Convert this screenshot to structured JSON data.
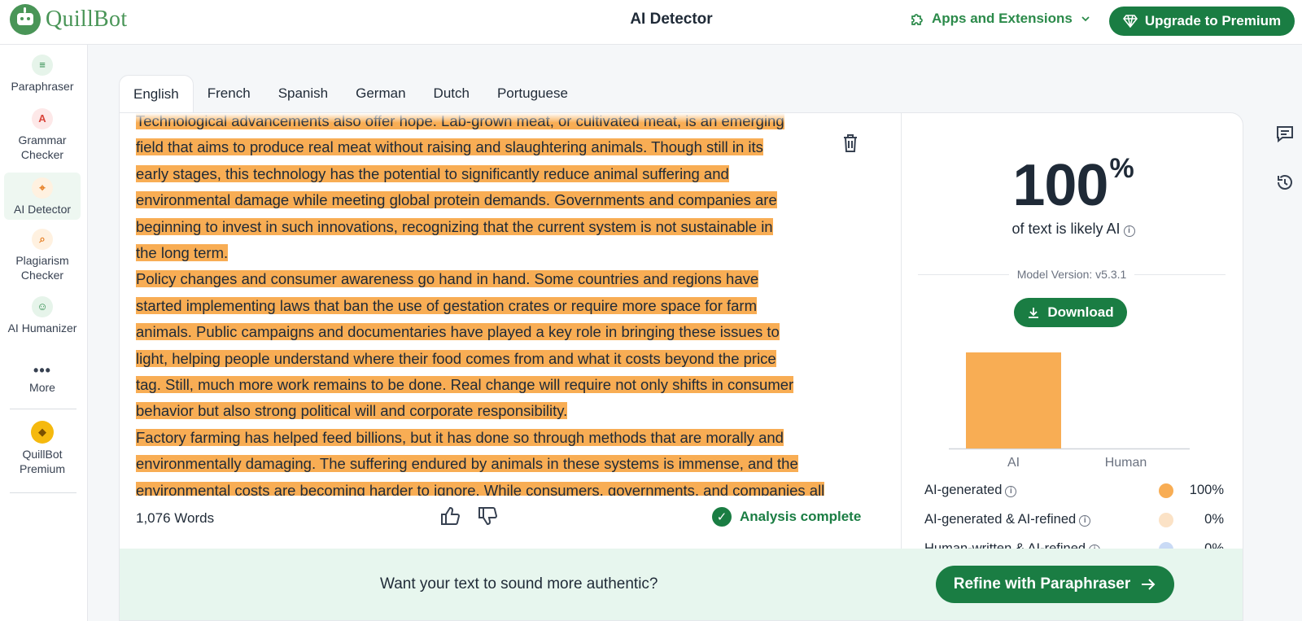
{
  "header": {
    "brand": "QuillBot",
    "title": "AI Detector",
    "apps_label": "Apps and Extensions",
    "upgrade_label": "Upgrade to Premium"
  },
  "sidebar": {
    "items": [
      {
        "label": "Paraphraser",
        "icon": "paraphraser-icon"
      },
      {
        "label": "Grammar Checker",
        "icon": "grammar-icon"
      },
      {
        "label": "AI Detector",
        "icon": "ai-detector-icon"
      },
      {
        "label": "Plagiarism Checker",
        "icon": "plagiarism-icon"
      },
      {
        "label": "AI Humanizer",
        "icon": "humanizer-icon"
      },
      {
        "label": "More",
        "icon": "more-icon"
      },
      {
        "label": "QuillBot Premium",
        "icon": "premium-diamond-icon"
      }
    ]
  },
  "tabs": [
    "English",
    "French",
    "Spanish",
    "German",
    "Dutch",
    "Portuguese"
  ],
  "editor": {
    "lines": [
      "Technological advancements also offer hope. Lab-grown meat, or cultivated meat, is an emerging",
      "field that aims to produce real meat without raising and slaughtering animals. Though still in its",
      "early stages, this technology has the potential to significantly reduce animal suffering and",
      "environmental damage while meeting global protein demands. Governments and companies are",
      "beginning to invest in such innovations, recognizing that the current system is not sustainable in",
      "the long term.",
      "Policy changes and consumer awareness go hand in hand. Some countries and regions have",
      "started implementing laws that ban the use of gestation crates or require more space for farm",
      "animals. Public campaigns and documentaries have played a key role in bringing these issues to",
      "light, helping people understand where their food comes from and what it costs beyond the price",
      "tag. Still, much more work remains to be done. Real change will require not only shifts in consumer",
      "behavior but also strong political will and corporate responsibility.",
      "Factory farming has helped feed billions, but it has done so through methods that are morally and",
      "environmentally damaging. The suffering endured by animals in these systems is immense, and the",
      "environmental costs are becoming harder to ignore. While consumers, governments, and companies all"
    ],
    "word_count": "1,076 Words",
    "status": "Analysis complete"
  },
  "results": {
    "percent": "100",
    "percent_sign": "%",
    "caption": "of text is likely AI",
    "model_version": "Model Version: v5.3.1",
    "download_label": "Download",
    "chart_data": {
      "type": "bar",
      "categories": [
        "AI",
        "Human"
      ],
      "values": [
        100,
        0
      ],
      "colors": [
        "#f8ad54",
        "#a9c7f0"
      ]
    },
    "legend": [
      {
        "label": "AI-generated",
        "value": "100%",
        "color": "#f8ad54"
      },
      {
        "label": "AI-generated & AI-refined",
        "value": "0%",
        "color": "#fbe2c6"
      },
      {
        "label": "Human-written & AI-refined",
        "value": "0%",
        "color": "#c9daf5"
      }
    ]
  },
  "banner": {
    "text": "Want your text to sound more authentic?",
    "button": "Refine with Paraphraser"
  },
  "colors": {
    "brand_green": "#1a7d43",
    "highlight": "#f8ad54"
  }
}
